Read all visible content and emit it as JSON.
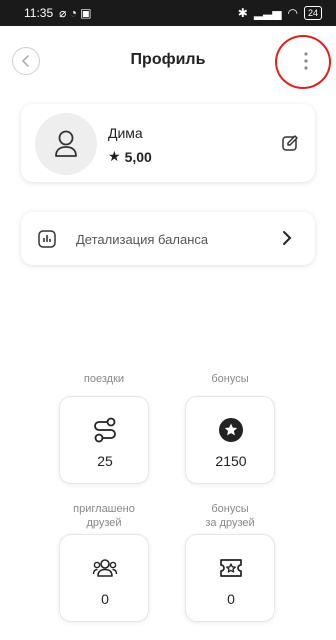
{
  "status_bar": {
    "time": "11:35",
    "battery": "24"
  },
  "header": {
    "title": "Профиль"
  },
  "profile": {
    "name": "Дима",
    "rating": "5,00"
  },
  "balance": {
    "label": "Детализация баланса"
  },
  "stats": [
    {
      "label": "поездки",
      "value": "25",
      "icon": "route-icon"
    },
    {
      "label": "бонусы",
      "value": "2150",
      "icon": "star-badge-icon"
    },
    {
      "label_line1": "приглашено",
      "label_line2": "друзей",
      "value": "0",
      "icon": "friends-icon"
    },
    {
      "label_line1": "бонусы",
      "label_line2": "за друзей",
      "value": "0",
      "icon": "ticket-star-icon"
    }
  ],
  "colors": {
    "annotation": "#e02020",
    "card_border": "#e6e6e6",
    "text": "#222222"
  }
}
